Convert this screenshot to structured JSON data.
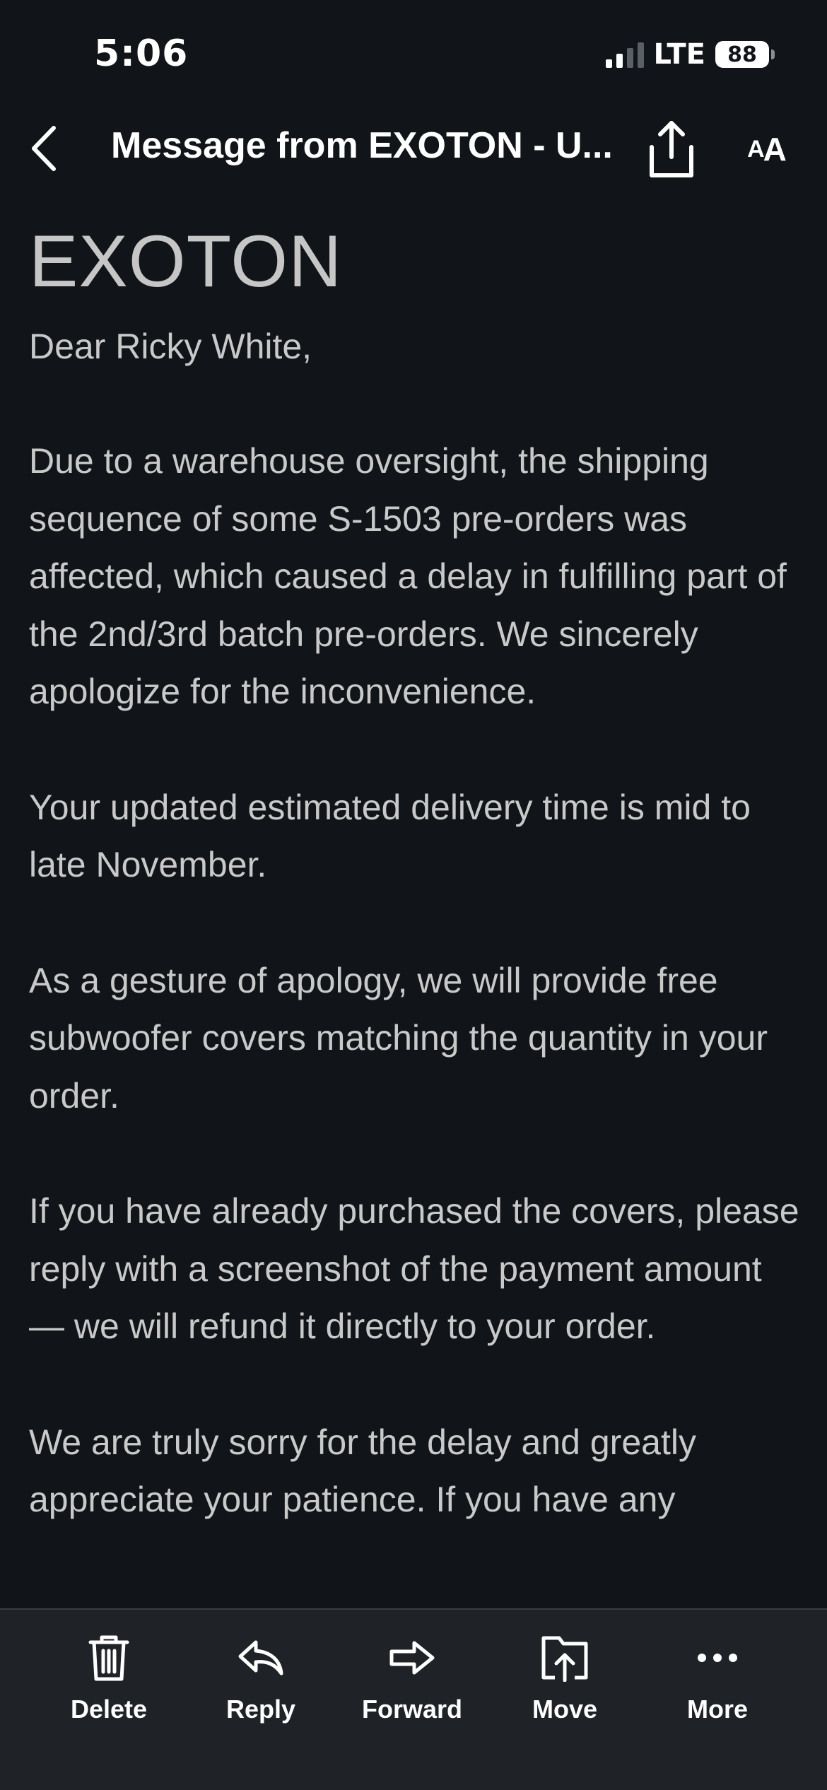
{
  "status_bar": {
    "time": "5:06",
    "network": "LTE",
    "battery": "88"
  },
  "nav": {
    "title": "Message from EXOTON - U...",
    "text_size_label_small": "A",
    "text_size_label_big": "A"
  },
  "email": {
    "logo": "EXOTON",
    "greeting": "Dear Ricky White,",
    "paragraphs": [
      "Due to a warehouse oversight, the shipping sequence of some S-1503 pre-orders was affected, which caused a delay in fulfilling part of the 2nd/3rd batch pre-orders. We sincerely apologize for the inconvenience.",
      "Your updated estimated delivery time is mid to late November.",
      "As a gesture of apology, we will provide free subwoofer covers matching the quantity in your order.",
      "If you have already purchased the covers, please reply with a screenshot of the payment amount — we will refund it directly to your order.",
      "We are truly sorry for the delay and greatly appreciate your patience. If you have any"
    ]
  },
  "toolbar": {
    "items": [
      {
        "label": "Delete",
        "icon": "trash-icon"
      },
      {
        "label": "Reply",
        "icon": "reply-icon"
      },
      {
        "label": "Forward",
        "icon": "forward-icon"
      },
      {
        "label": "Move",
        "icon": "move-icon"
      },
      {
        "label": "More",
        "icon": "more-icon"
      }
    ]
  },
  "colors": {
    "background": "#111418",
    "toolbar_background": "#1f2226",
    "body_text": "#c9c9c9",
    "logo_text": "#c6c6c6",
    "foreground": "#ffffff"
  }
}
